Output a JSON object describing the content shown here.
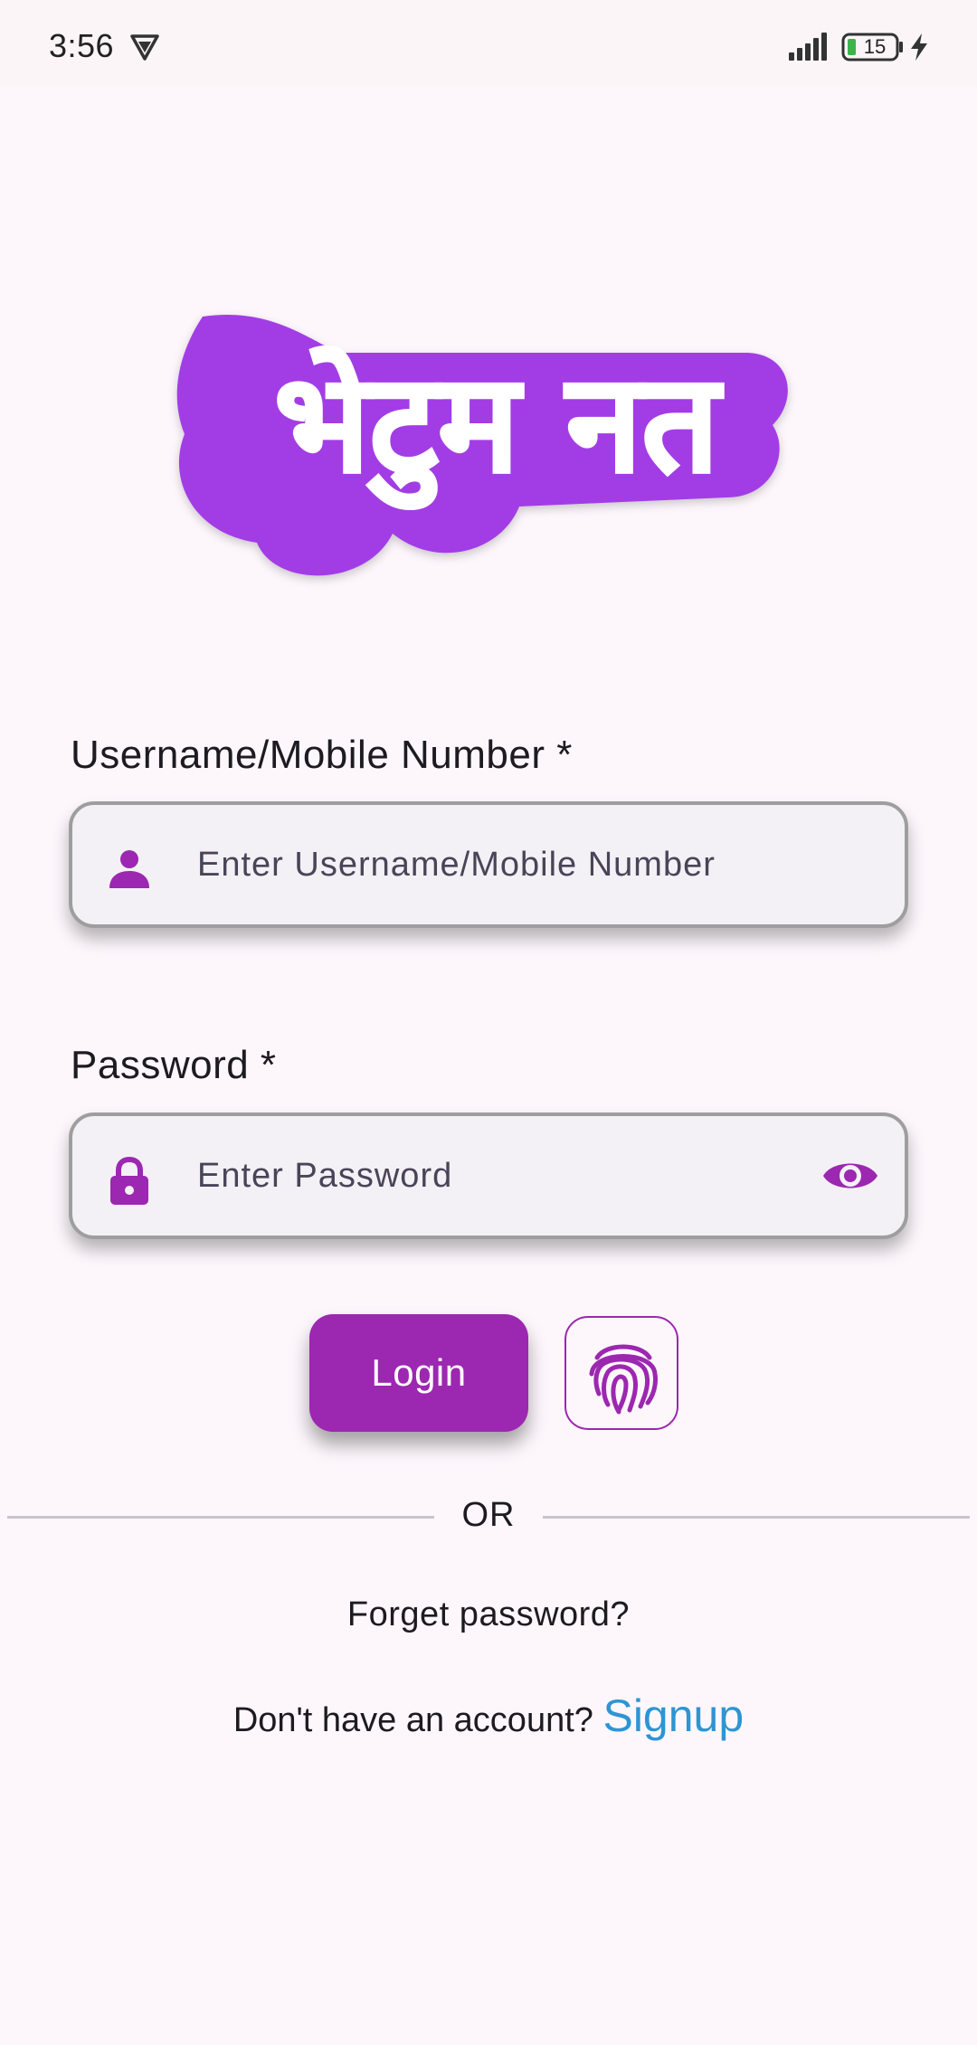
{
  "status_bar": {
    "time": "3:56",
    "battery": "15",
    "icons": [
      "vpn-shield-icon",
      "signal-icon",
      "battery-icon",
      "charging-icon"
    ]
  },
  "logo": {
    "text": "भेटुम नत",
    "fill_color": "#A23CE6",
    "outline_color": "#ffffff"
  },
  "form": {
    "username": {
      "label": "Username/Mobile Number *",
      "placeholder": "Enter Username/Mobile Number",
      "value": "",
      "icon": "person-icon"
    },
    "password": {
      "label": "Password *",
      "placeholder": "Enter Password",
      "value": "",
      "icon": "lock-icon",
      "toggle_icon": "eye-icon"
    },
    "login_label": "Login",
    "fingerprint_icon": "fingerprint-icon"
  },
  "divider": {
    "text": "OR"
  },
  "links": {
    "forget": "Forget password?",
    "no_account": "Don't have an account? ",
    "signup": "Signup"
  },
  "colors": {
    "primary": "#9C27B0",
    "background": "#FDF7FC",
    "link": "#2E95D3",
    "input_fill": "#F4F1F6",
    "input_border": "#9E9E9E"
  }
}
